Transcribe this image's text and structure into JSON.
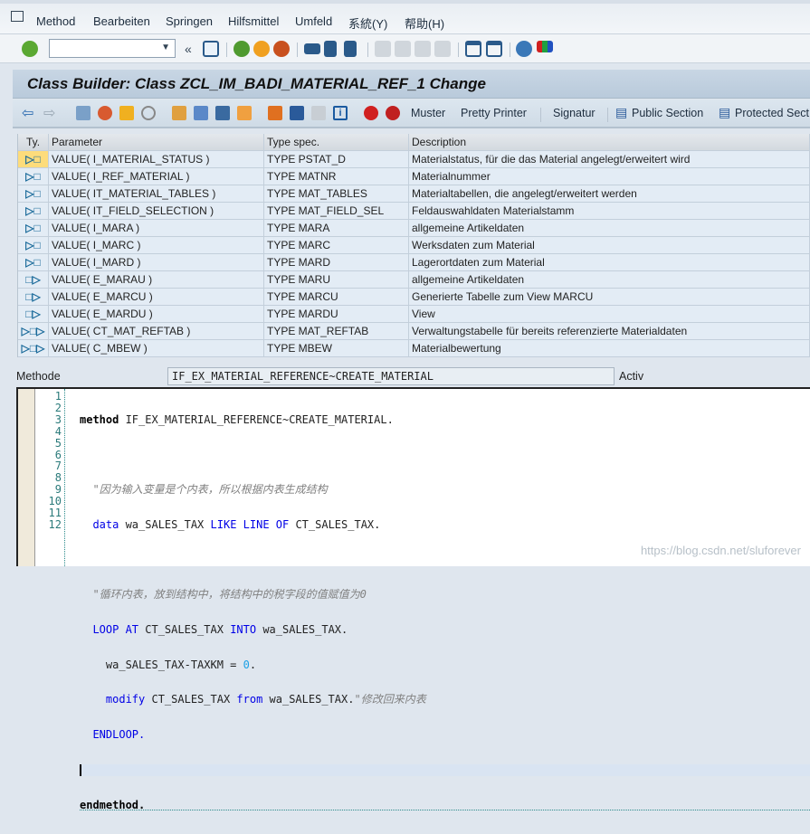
{
  "menu": [
    "Method",
    "Bearbeiten",
    "Springen",
    "Hilfsmittel",
    "Umfeld",
    "系統(Y)",
    "帮助(H)"
  ],
  "command_field": {
    "value": ""
  },
  "title": "Class Builder: Class ZCL_IM_BADI_MATERIAL_REF_1 Change",
  "app_toolbar": {
    "muster": "Muster",
    "pretty_printer": "Pretty Printer",
    "signatur": "Signatur",
    "public_section": "Public Section",
    "protected_section": "Protected Sect"
  },
  "table": {
    "headers": [
      "Ty.",
      "Parameter",
      "Type spec.",
      "Description"
    ],
    "rows": [
      {
        "kind": "importing",
        "icon": "▷□",
        "param": "VALUE( I_MATERIAL_STATUS )",
        "type": "TYPE PSTAT_D",
        "desc": "Materialstatus, für die das Material angelegt/erweitert wird"
      },
      {
        "kind": "importing",
        "icon": "▷□",
        "param": "VALUE( I_REF_MATERIAL )",
        "type": "TYPE MATNR",
        "desc": "Materialnummer"
      },
      {
        "kind": "importing",
        "icon": "▷□",
        "param": "VALUE( IT_MATERIAL_TABLES )",
        "type": "TYPE MAT_TABLES",
        "desc": "Materialtabellen, die angelegt/erweitert werden"
      },
      {
        "kind": "importing",
        "icon": "▷□",
        "param": "VALUE( IT_FIELD_SELECTION )",
        "type": "TYPE MAT_FIELD_SEL",
        "desc": "Feldauswahldaten Materialstamm"
      },
      {
        "kind": "importing",
        "icon": "▷□",
        "param": "VALUE( I_MARA )",
        "type": "TYPE MARA",
        "desc": "allgemeine Artikeldaten"
      },
      {
        "kind": "importing",
        "icon": "▷□",
        "param": "VALUE( I_MARC )",
        "type": "TYPE MARC",
        "desc": "Werksdaten zum Material"
      },
      {
        "kind": "importing",
        "icon": "▷□",
        "param": "VALUE( I_MARD )",
        "type": "TYPE MARD",
        "desc": "Lagerortdaten zum Material"
      },
      {
        "kind": "exporting",
        "icon": "□▷",
        "param": "VALUE( E_MARAU )",
        "type": "TYPE MARU",
        "desc": "allgemeine Artikeldaten"
      },
      {
        "kind": "exporting",
        "icon": "□▷",
        "param": "VALUE( E_MARCU )",
        "type": "TYPE MARCU",
        "desc": "Generierte Tabelle zum View MARCU"
      },
      {
        "kind": "exporting",
        "icon": "□▷",
        "param": "VALUE( E_MARDU )",
        "type": "TYPE MARDU",
        "desc": "View"
      },
      {
        "kind": "changing",
        "icon": "▷□▷",
        "param": "VALUE( CT_MAT_REFTAB )",
        "type": "TYPE MAT_REFTAB",
        "desc": "Verwaltungstabelle für bereits referenzierte Materialdaten"
      },
      {
        "kind": "changing",
        "icon": "▷□▷",
        "param": "VALUE( C_MBEW )",
        "type": "TYPE MBEW",
        "desc": "Materialbewertung"
      }
    ]
  },
  "method": {
    "label": "Methode",
    "name": "IF_EX_MATERIAL_REFERENCE~CREATE_MATERIAL",
    "status": "Activ"
  },
  "code": {
    "line_numbers": [
      "1",
      "2",
      "3",
      "4",
      "5",
      "6",
      "7",
      "8",
      "9",
      "10",
      "11",
      "12"
    ],
    "l1a": "method",
    "l1b": " IF_EX_MATERIAL_REFERENCE~CREATE_MATERIAL.",
    "l3": "  \"因为输入变量是个内表，所以根据内表生成结构",
    "l4a": "  data",
    "l4b": " wa_SALES_TAX ",
    "l4c": "LIKE LINE OF",
    "l4d": " CT_SALES_TAX.",
    "l6": "  \"循环内表，放到结构中，将结构中的税字段的值赋值为0",
    "l7a": "  LOOP AT",
    "l7b": " CT_SALES_TAX ",
    "l7c": "INTO",
    "l7d": " wa_SALES_TAX.",
    "l8a": "    wa_SALES_TAX-TAXKM = ",
    "l8b": "0",
    "l8c": ".",
    "l9a": "    modify",
    "l9b": " CT_SALES_TAX ",
    "l9c": "from",
    "l9d": " wa_SALES_TAX.",
    "l9e": "\"修改回来内表",
    "l10": "  ENDLOOP.",
    "l12": "endmethod."
  },
  "watermark": "https://blog.csdn.net/sluforever"
}
